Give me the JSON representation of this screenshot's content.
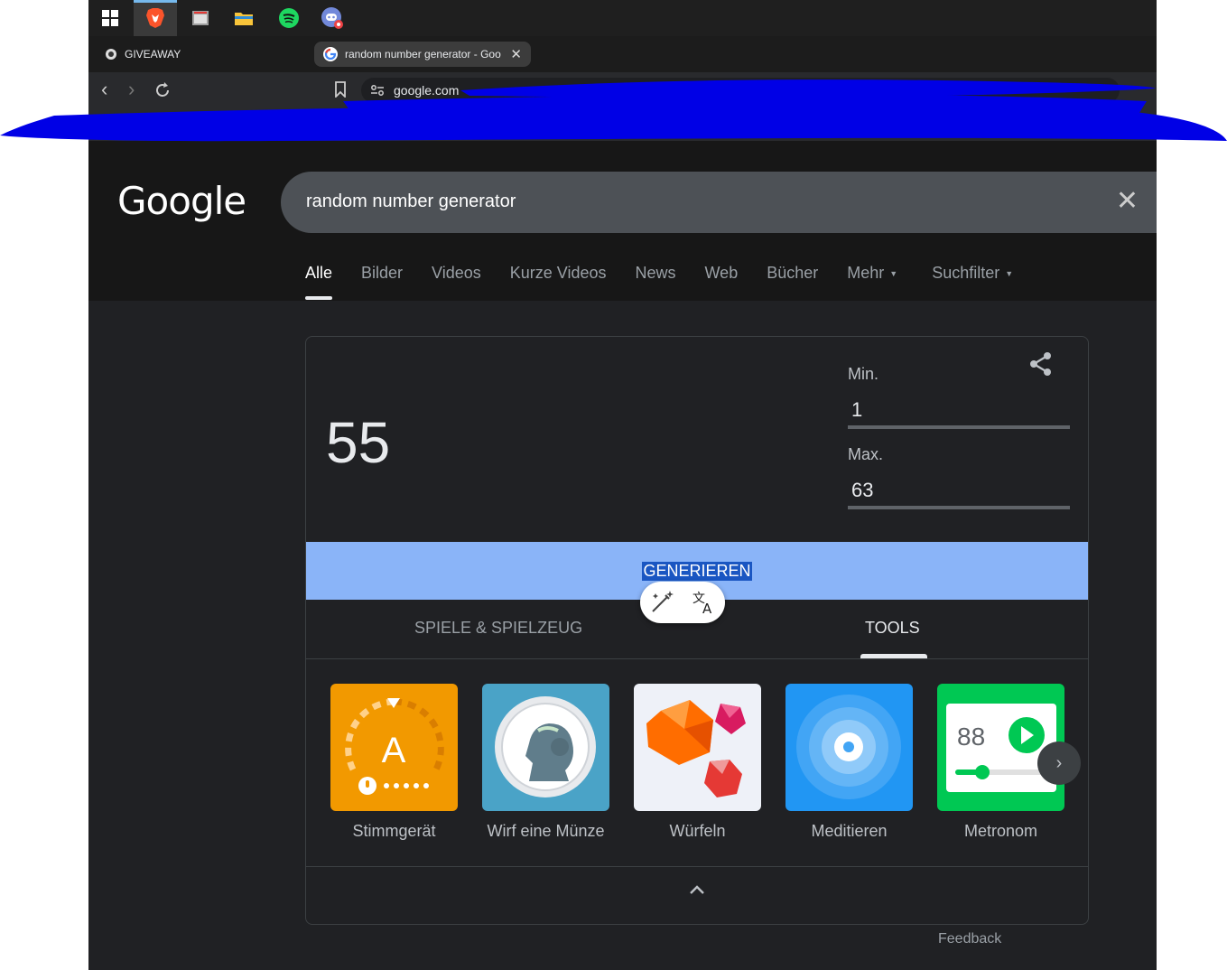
{
  "browser": {
    "tabs": [
      {
        "title": "GIVEAWAY"
      },
      {
        "title": "random number generator - Goo",
        "active": true
      }
    ],
    "new_tab": "+",
    "url": "google.com"
  },
  "google": {
    "logo": "Google",
    "query": "random number generator",
    "nav_tabs": [
      "Alle",
      "Bilder",
      "Videos",
      "Kurze Videos",
      "News",
      "Web",
      "Bücher",
      "Mehr",
      "Suchfilter"
    ],
    "active_tab": "Alle"
  },
  "rng": {
    "result": "55",
    "min_label": "Min.",
    "min_value": "1",
    "max_label": "Max.",
    "max_value": "63",
    "button_label": "GENERIEREN"
  },
  "categories": {
    "games": "SPIELE & SPIELZEUG",
    "tools": "TOOLS"
  },
  "tools": [
    {
      "label": "Stimmgerät",
      "icon": "tuner-icon",
      "color": "#f29900"
    },
    {
      "label": "Wirf eine Münze",
      "icon": "coin-icon",
      "color": "#4aa3c7"
    },
    {
      "label": "Würfeln",
      "icon": "dice-icon",
      "color": "#eef1f8"
    },
    {
      "label": "Meditieren",
      "icon": "meditate-icon",
      "color": "#2196f3"
    },
    {
      "label": "Metronom",
      "icon": "metronome-icon",
      "color": "#00c853"
    }
  ],
  "metronome_bpm": "88",
  "tuner_letter": "A",
  "feedback": "Feedback"
}
